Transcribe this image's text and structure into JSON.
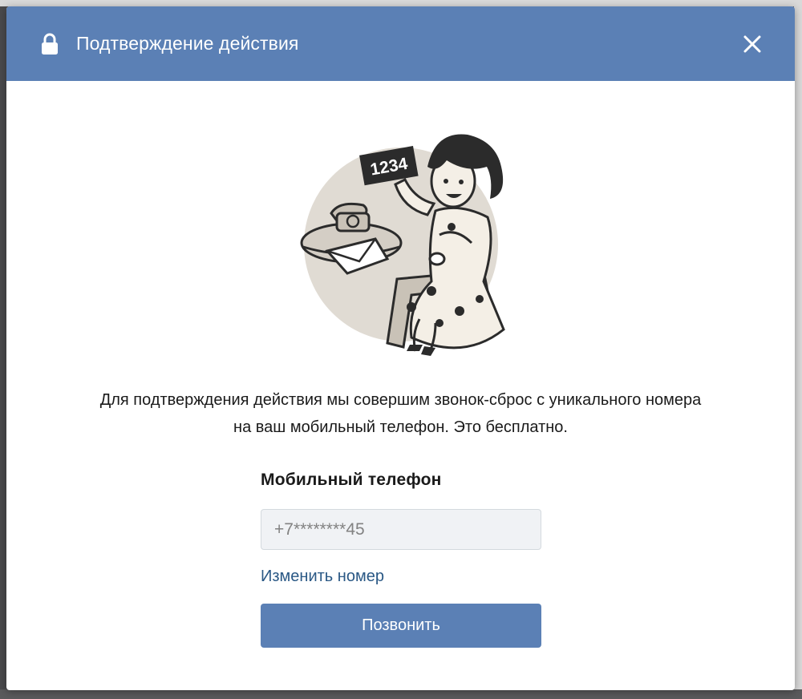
{
  "modal": {
    "title": "Подтверждение действия",
    "icons": {
      "header": "lock-icon",
      "close": "close-icon"
    }
  },
  "illustration": {
    "sign_text": "1234",
    "description": "woman-holding-code-card-illustration"
  },
  "body": {
    "description_line1": "Для подтверждения действия мы совершим звонок-сброс с уникального номера",
    "description_line2": "на ваш мобильный телефон. Это бесплатно."
  },
  "form": {
    "phone_label": "Мобильный телефон",
    "phone_value": "+7********45",
    "change_number_link": "Изменить номер",
    "call_button": "Позвонить"
  },
  "colors": {
    "header_bg": "#5b80b5",
    "button_bg": "#5b80b5",
    "link": "#2a5885",
    "input_bg": "#f0f2f5"
  }
}
